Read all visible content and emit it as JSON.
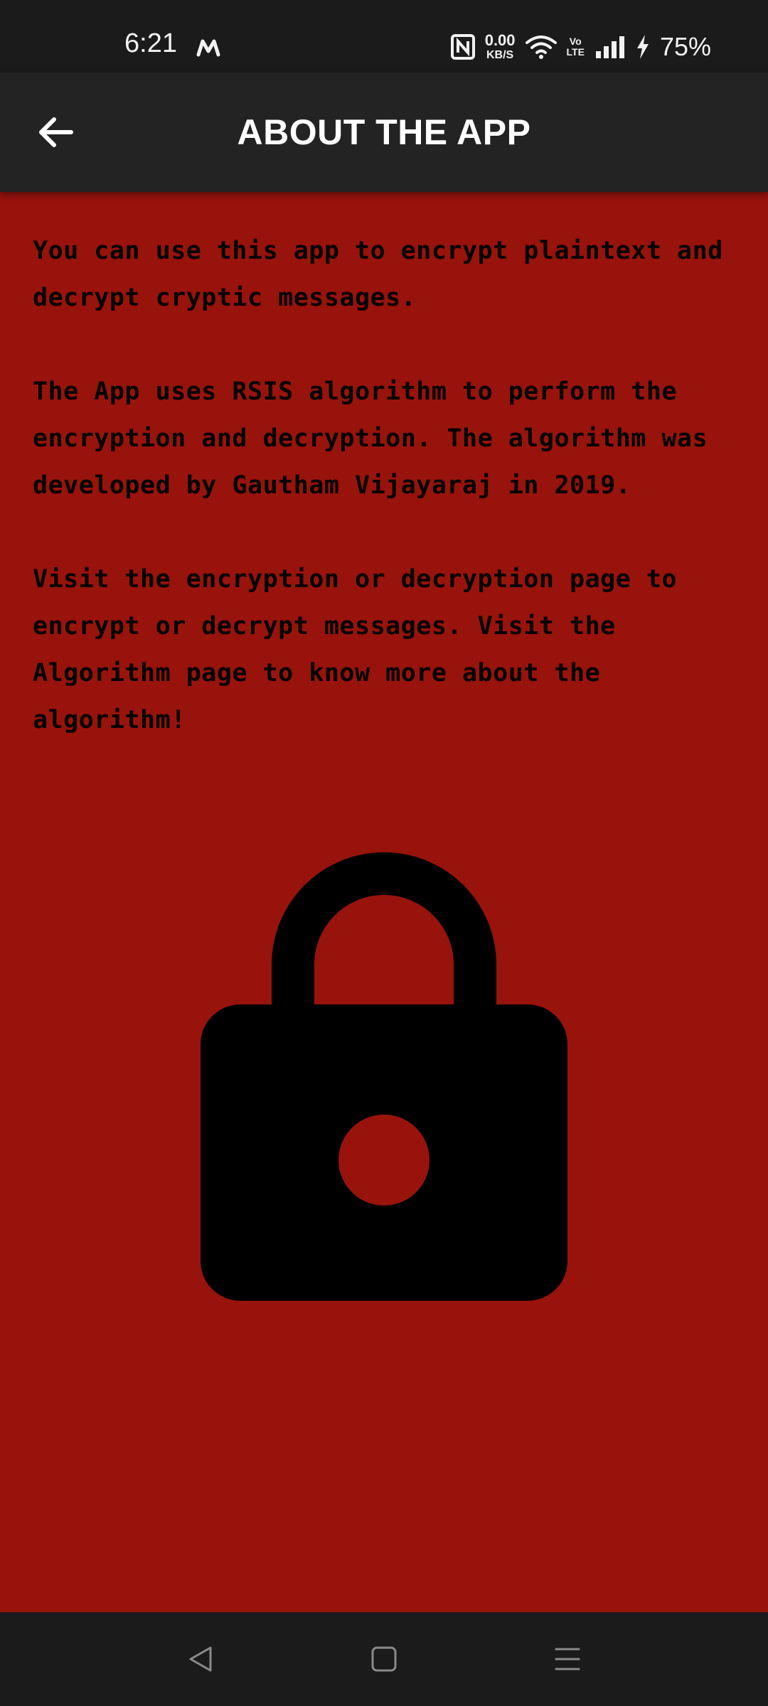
{
  "status_bar": {
    "time": "6:21",
    "net_speed_value": "0.00",
    "net_speed_unit": "KB/S",
    "volte_top": "Vo",
    "volte_bottom": "LTE",
    "battery": "75%"
  },
  "app_bar": {
    "title": "ABOUT THE APP"
  },
  "content": {
    "paragraphs": [
      "You can use this app to encrypt plaintext and decrypt cryptic messages.",
      "The App uses RSIS algorithm to perform the encryption and decryption. The algorithm was developed by Gautham Vijayaraj in 2019.",
      "Visit the encryption or decryption page to encrypt or decrypt messages. Visit the Algorithm page to know more about the algorithm!"
    ]
  },
  "icons": {
    "back": "arrow-back-icon",
    "lock": "lock-icon",
    "nav_back": "triangle-back-icon",
    "nav_home": "square-home-icon",
    "nav_menu": "menu-lines-icon"
  },
  "colors": {
    "background_red": "#98130b",
    "app_bar": "#232323",
    "status_bar": "#1b1b1b",
    "text": "#000000"
  }
}
